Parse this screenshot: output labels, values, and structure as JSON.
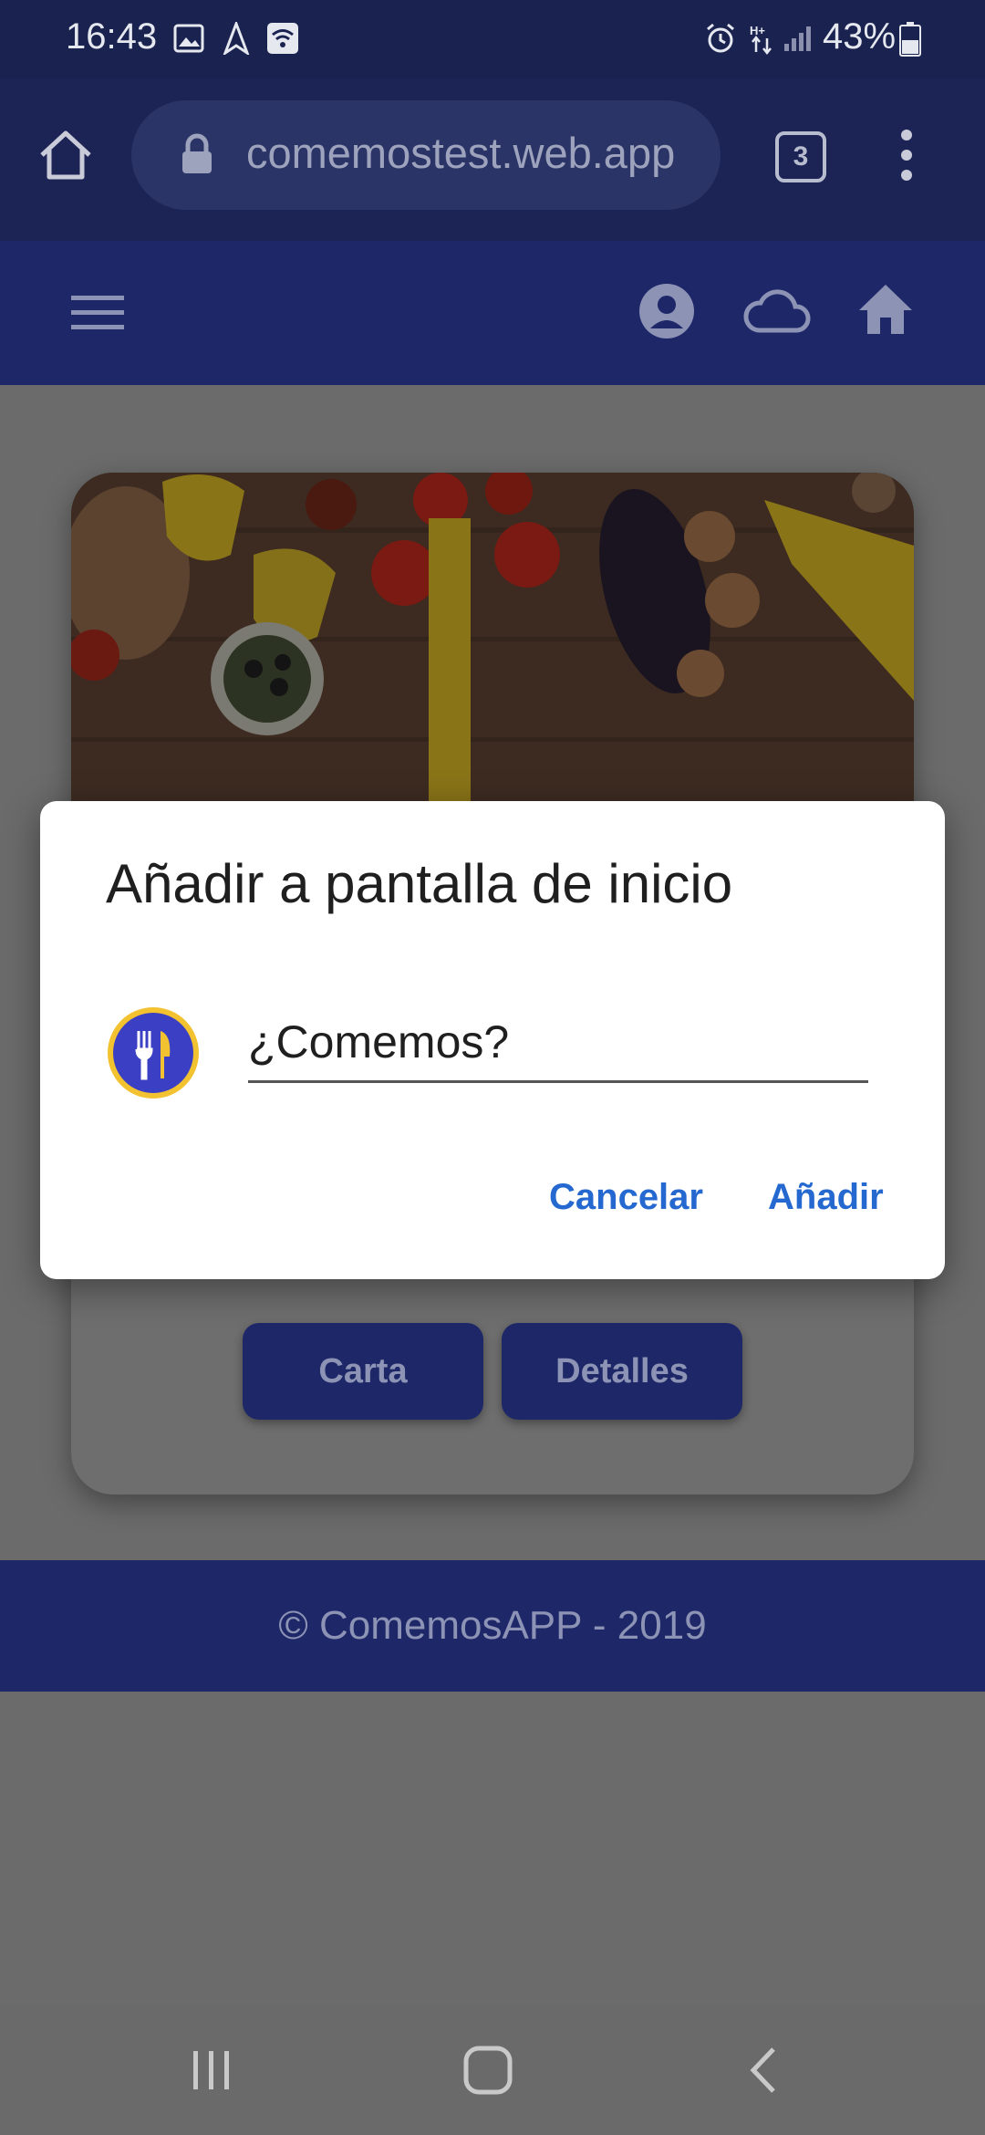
{
  "status_bar": {
    "time": "16:43",
    "battery_percent": "43%"
  },
  "browser": {
    "url": "comemostest.web.app",
    "tab_count": "3"
  },
  "page": {
    "buttons": {
      "menu_label": "Carta",
      "details_label": "Detalles"
    },
    "footer_text": "© ComemosAPP - 2019"
  },
  "dialog": {
    "title": "Añadir a pantalla de inicio",
    "name_value": "¿Comemos?",
    "cancel_label": "Cancelar",
    "add_label": "Añadir"
  },
  "colors": {
    "primary": "#1e2868",
    "dialog_action": "#2569d0",
    "icon_ring": "#f2c230",
    "icon_fill": "#3a3fc4"
  },
  "icons": [
    "home-icon",
    "lock-icon",
    "tabs-icon",
    "more-icon",
    "menu-icon",
    "account-icon",
    "cloud-icon",
    "app-home-icon",
    "fork-knife-icon",
    "recents-icon",
    "nav-home-icon",
    "back-icon"
  ]
}
